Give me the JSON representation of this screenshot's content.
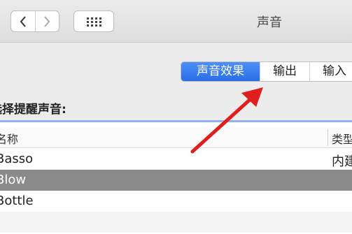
{
  "window": {
    "title": "声音"
  },
  "toolbar": {
    "back_icon": "chevron-left-icon",
    "forward_icon": "chevron-right-icon",
    "grid_icon": "grid-icon"
  },
  "tabs": [
    {
      "label": "声音效果",
      "selected": true
    },
    {
      "label": "输出",
      "selected": false
    },
    {
      "label": "输入",
      "selected": false
    }
  ],
  "alert": {
    "prompt": "选择提醒声音:",
    "columns": [
      "名称",
      "类型"
    ],
    "rows": [
      {
        "name": "Basso",
        "type": "内建"
      },
      {
        "name": "Blow",
        "type": ""
      },
      {
        "name": "Bottle",
        "type": ""
      }
    ]
  },
  "colors": {
    "accent": "#2a6fe6",
    "arrow": "#e11e1e",
    "selected_row": "#8a8a8a"
  }
}
